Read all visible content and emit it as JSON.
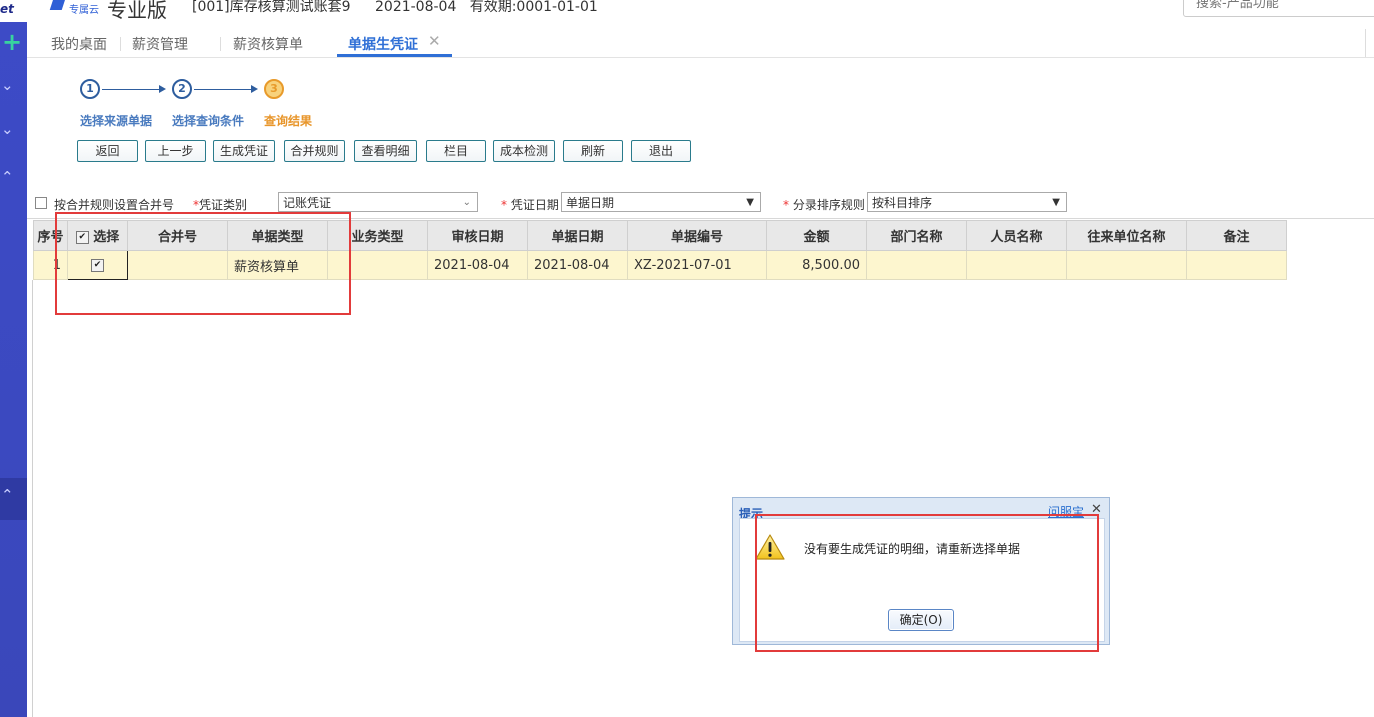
{
  "header": {
    "brand_small": "专属云",
    "brand_name": "专业版",
    "account": "[001]库存核算测试账套9",
    "date_info": "2021-08-04   有效期:0001-01-01",
    "search_placeholder": "搜索-产品功能"
  },
  "rail": {
    "logo_fragment": "et"
  },
  "tabs": [
    {
      "label": "我的桌面"
    },
    {
      "label": "薪资管理"
    },
    {
      "label": "薪资核算单"
    },
    {
      "label": "单据生凭证",
      "active": true
    }
  ],
  "steps": [
    {
      "number": "1",
      "label": "选择来源单据"
    },
    {
      "number": "2",
      "label": "选择查询条件"
    },
    {
      "number": "3",
      "label": "查询结果",
      "current": true
    }
  ],
  "toolbar": [
    "返回",
    "上一步",
    "生成凭证",
    "合并规则",
    "查看明细",
    "栏目",
    "成本检测",
    "刷新",
    "退出"
  ],
  "filters": {
    "merge_checkbox_label": "按合并规则设置合并号",
    "voucher_type_label": "凭证类别",
    "voucher_type_value": "记账凭证",
    "voucher_date_label": "凭证日期",
    "voucher_date_value": "单据日期",
    "sort_rule_label": "分录排序规则",
    "sort_rule_value": "按科目排序",
    "required_mark": "*"
  },
  "grid": {
    "columns": [
      "序号",
      "选择",
      "合并号",
      "单据类型",
      "业务类型",
      "审核日期",
      "单据日期",
      "单据编号",
      "金额",
      "部门名称",
      "人员名称",
      "往来单位名称",
      "备注"
    ],
    "rows": [
      {
        "seq": "1",
        "selected": true,
        "merge_no": "",
        "doc_type": "薪资核算单",
        "biz_type": "",
        "audit_date": "2021-08-04",
        "doc_date": "2021-08-04",
        "doc_no": "XZ-2021-07-01",
        "amount": "8,500.00",
        "dept": "",
        "person": "",
        "partner": "",
        "remark": ""
      }
    ]
  },
  "dialog": {
    "title": "提示",
    "help_link": "问服宝",
    "message": "没有要生成凭证的明细，请重新选择单据",
    "ok_label": "确定(O)"
  },
  "colors": {
    "rail": "#3d4bc7",
    "accent": "#2f6fd6",
    "step_current": "#e8962b",
    "row_highlight": "#fdf6cf",
    "annotation_red": "#e23b3b"
  }
}
